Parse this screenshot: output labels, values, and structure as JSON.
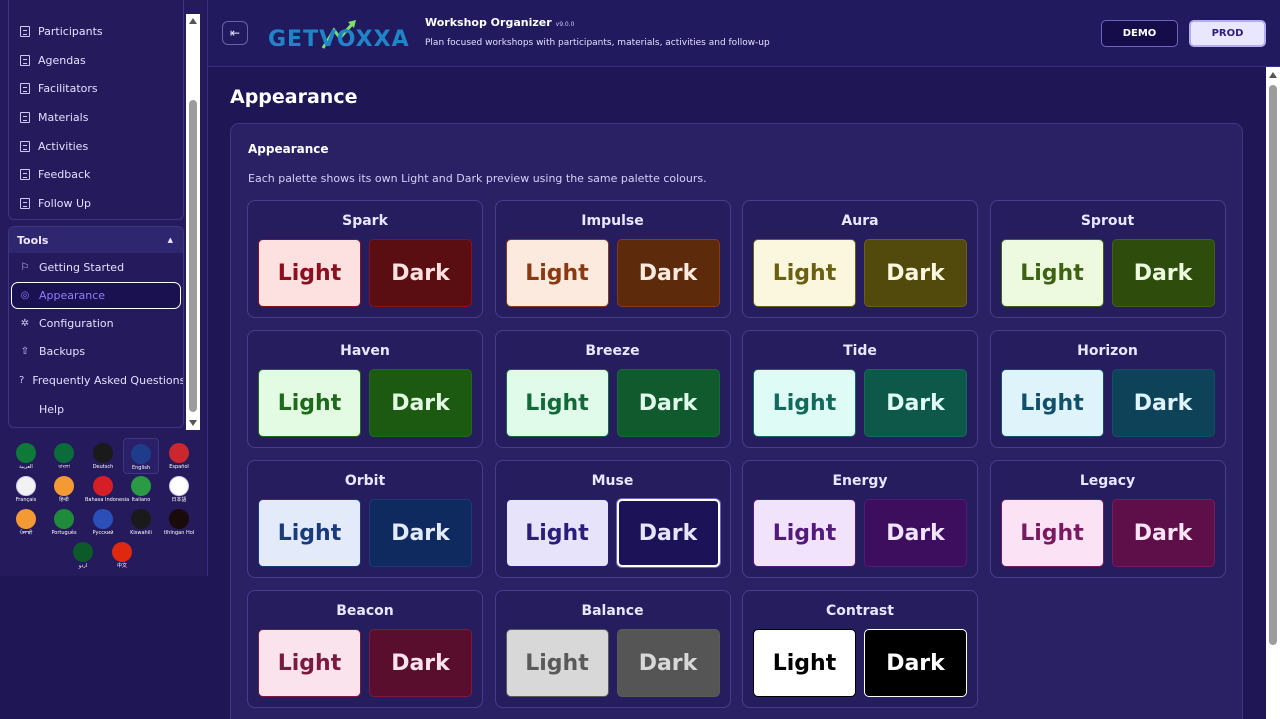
{
  "sidebar": {
    "nav_items": [
      "Participants",
      "Agendas",
      "Facilitators",
      "Materials",
      "Activities",
      "Feedback",
      "Follow Up"
    ],
    "tools": {
      "title": "Tools",
      "items": [
        {
          "label": "Getting Started",
          "icon": "flag-icon"
        },
        {
          "label": "Appearance",
          "icon": "palette-icon",
          "active": true
        },
        {
          "label": "Configuration",
          "icon": "gear-icon"
        },
        {
          "label": "Backups",
          "icon": "upload-icon"
        },
        {
          "label": "Frequently Asked Questions",
          "icon": "question-icon"
        },
        {
          "label": "Help",
          "icon": ""
        }
      ]
    },
    "languages": [
      {
        "name": "العربية",
        "color": "#0d7a3a"
      },
      {
        "name": "বাংলা",
        "color": "#0b6b3a"
      },
      {
        "name": "Deutsch",
        "color": "#1a1a1a"
      },
      {
        "name": "English",
        "color": "#1f3c8a",
        "selected": true
      },
      {
        "name": "Español",
        "color": "#c8282e"
      },
      {
        "name": "Français",
        "color": "#f2f2f2"
      },
      {
        "name": "हिन्दी",
        "color": "#f39a35"
      },
      {
        "name": "Bahasa Indonesia",
        "color": "#d41f26"
      },
      {
        "name": "Italiano",
        "color": "#2a9a45"
      },
      {
        "name": "日本語",
        "color": "#ffffff"
      },
      {
        "name": "ਪੰਜਾਬੀ",
        "color": "#f39a35"
      },
      {
        "name": "Português",
        "color": "#1f8a3a"
      },
      {
        "name": "Русский",
        "color": "#2a4fb8"
      },
      {
        "name": "Kiswahili",
        "color": "#1a1a1a"
      },
      {
        "name": "tlhIngan Hol",
        "color": "#1a0a0a"
      },
      {
        "name": "اردو",
        "color": "#0c5a2a"
      },
      {
        "name": "中文",
        "color": "#de2910"
      }
    ]
  },
  "header": {
    "logo_text": "GETVOXXA",
    "app_title": "Workshop Organizer",
    "version": "v9.0.0",
    "subtitle": "Plan focused workshops with participants, materials, activities and follow-up",
    "demo_label": "DEMO",
    "prod_label": "PROD"
  },
  "main": {
    "page_title": "Appearance",
    "card_title": "Appearance",
    "card_desc": "Each palette shows its own Light and Dark preview using the same palette colours.",
    "light_label": "Light",
    "dark_label": "Dark",
    "palettes": [
      {
        "name": "Spark",
        "light_bg": "#fde0e0",
        "light_fg": "#8a1020",
        "dark_bg": "#5a0e12",
        "dark_fg": "#fde0e0"
      },
      {
        "name": "Impulse",
        "light_bg": "#fdeadf",
        "light_fg": "#8a3a12",
        "dark_bg": "#5e2a0c",
        "dark_fg": "#fdeadf"
      },
      {
        "name": "Aura",
        "light_bg": "#fbf7df",
        "light_fg": "#6b6012",
        "dark_bg": "#524a0c",
        "dark_fg": "#fbf7df"
      },
      {
        "name": "Sprout",
        "light_bg": "#edfadf",
        "light_fg": "#3e6212",
        "dark_bg": "#2e4c0c",
        "dark_fg": "#edfadf"
      },
      {
        "name": "Haven",
        "light_bg": "#e3fbe3",
        "light_fg": "#1d6a1a",
        "dark_bg": "#1c5a12",
        "dark_fg": "#e3fbe3"
      },
      {
        "name": "Breeze",
        "light_bg": "#e1fbeb",
        "light_fg": "#126a3a",
        "dark_bg": "#105a2e",
        "dark_fg": "#e1fbeb"
      },
      {
        "name": "Tide",
        "light_bg": "#dffbf5",
        "light_fg": "#126a5a",
        "dark_bg": "#0e584a",
        "dark_fg": "#dffbf5"
      },
      {
        "name": "Horizon",
        "light_bg": "#dff3fb",
        "light_fg": "#12506a",
        "dark_bg": "#0e4258",
        "dark_fg": "#dff3fb"
      },
      {
        "name": "Orbit",
        "light_bg": "#e3ebfb",
        "light_fg": "#1a3a7a",
        "dark_bg": "#0e2a5e",
        "dark_fg": "#e3ebfb"
      },
      {
        "name": "Muse",
        "light_bg": "#e7e3fb",
        "light_fg": "#2a1e7a",
        "dark_bg": "#1c1258",
        "dark_fg": "#e7e3fb",
        "selected": "dark"
      },
      {
        "name": "Energy",
        "light_bg": "#f1e3fb",
        "light_fg": "#521a7a",
        "dark_bg": "#3e0e5e",
        "dark_fg": "#f1e3fb"
      },
      {
        "name": "Legacy",
        "light_bg": "#fbe3f5",
        "light_fg": "#7a1a5e",
        "dark_bg": "#5e0e48",
        "dark_fg": "#fbe3f5"
      },
      {
        "name": "Beacon",
        "light_bg": "#fbe3ee",
        "light_fg": "#7a1a3e",
        "dark_bg": "#5a0e2e",
        "dark_fg": "#fbe3ee"
      },
      {
        "name": "Balance",
        "light_bg": "#d8d8d8",
        "light_fg": "#5a5a5a",
        "dark_bg": "#555555",
        "dark_fg": "#d8d8d8"
      },
      {
        "name": "Contrast",
        "light_bg": "#ffffff",
        "light_fg": "#000000",
        "dark_bg": "#000000",
        "dark_fg": "#ffffff"
      }
    ]
  }
}
